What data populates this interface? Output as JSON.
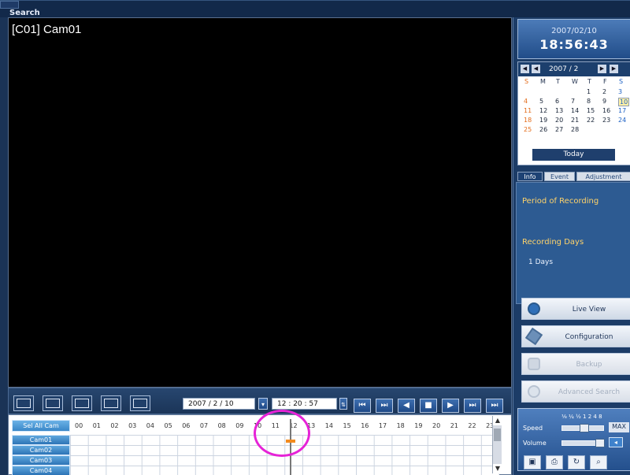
{
  "window": {
    "title": "Search"
  },
  "video": {
    "camera_label": "[C01] Cam01"
  },
  "controls": {
    "date": "2007 / 2 / 10",
    "time": "12 : 20 : 57",
    "playback_buttons": [
      "⏮",
      "⏭",
      "◀",
      "■",
      "▶",
      "⏭",
      "⏭"
    ]
  },
  "timeline": {
    "select_all": "Sel All Cam",
    "hours": [
      "00",
      "01",
      "02",
      "03",
      "04",
      "05",
      "06",
      "07",
      "08",
      "09",
      "10",
      "11",
      "12",
      "13",
      "14",
      "15",
      "16",
      "17",
      "18",
      "19",
      "20",
      "21",
      "22",
      "23"
    ],
    "cameras": [
      "Cam01",
      "Cam02",
      "Cam03",
      "Cam04"
    ]
  },
  "clock": {
    "date": "2007/02/10",
    "time": "18:56:43"
  },
  "calendar": {
    "month": "2007 / 2",
    "weekdays": [
      "S",
      "M",
      "T",
      "W",
      "T",
      "F",
      "S"
    ],
    "weeks": [
      [
        "",
        "",
        "",
        "",
        "1",
        "2",
        "3"
      ],
      [
        "4",
        "5",
        "6",
        "7",
        "8",
        "9",
        "10"
      ],
      [
        "11",
        "12",
        "13",
        "14",
        "15",
        "16",
        "17"
      ],
      [
        "18",
        "19",
        "20",
        "21",
        "22",
        "23",
        "24"
      ],
      [
        "25",
        "26",
        "27",
        "28",
        "",
        "",
        ""
      ]
    ],
    "today": "Today"
  },
  "tabs": [
    "Info",
    "Event",
    "Adjustment"
  ],
  "info": {
    "period_label": "Period of Recording",
    "recording_days_label": "Recording Days",
    "days_value": "1 Days"
  },
  "side_buttons": [
    "Live View",
    "Configuration",
    "Backup",
    "Advanced Search"
  ],
  "speed": {
    "scale": "⅛ ¼ ½ 1 2 4 8",
    "speed_label": "Speed",
    "volume_label": "Volume",
    "max_label": "MAX"
  },
  "colors": {
    "panel": "#1c3c67",
    "accent": "#2d5b92",
    "highlight": "#e623d7",
    "marker": "#f38b1f"
  }
}
